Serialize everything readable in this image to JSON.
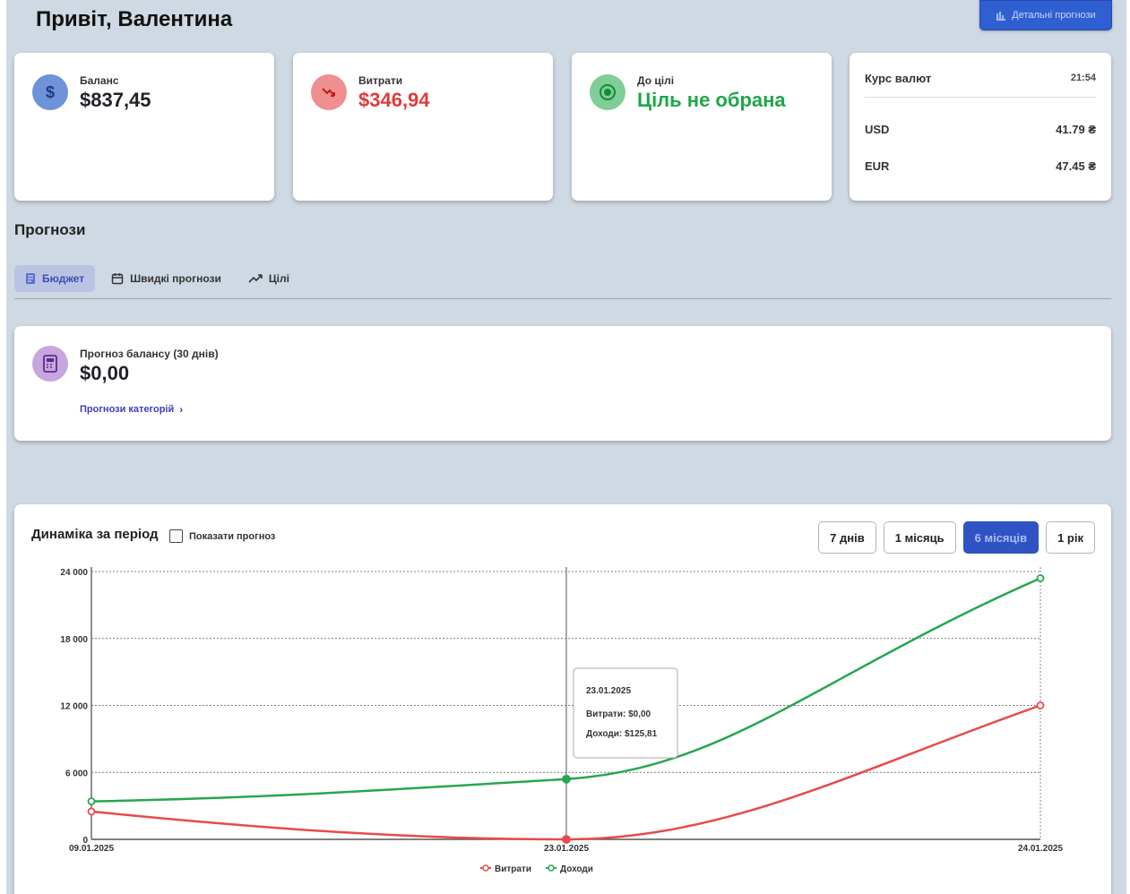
{
  "header": {
    "greeting": "Привіт, Валентина",
    "detail_button": "Детальні прогнози"
  },
  "stats": {
    "balance": {
      "label": "Баланс",
      "value": "$837,45",
      "icon": "dollar-icon",
      "icon_color": "#6f93d8",
      "value_color": "#1f2328"
    },
    "expenses": {
      "label": "Витрати",
      "value": "$346,94",
      "icon": "trend-down-icon",
      "icon_color": "#ef8f8f",
      "value_color": "#e03b3b"
    },
    "goal": {
      "label": "До цілі",
      "value": "Ціль не обрана",
      "icon": "target-icon",
      "icon_color": "#7fce97",
      "value_color": "#1fa64a"
    }
  },
  "rates": {
    "title": "Курс валют",
    "time": "21:54",
    "rows": [
      {
        "currency": "USD",
        "value": "41.79 ₴"
      },
      {
        "currency": "EUR",
        "value": "47.45 ₴"
      }
    ]
  },
  "forecasts": {
    "title": "Прогнози",
    "tabs": [
      {
        "label": "Бюджет",
        "icon": "budget-icon"
      },
      {
        "label": "Швидкі прогнози",
        "icon": "calendar-icon"
      },
      {
        "label": "Цілі",
        "icon": "trend-up-icon"
      }
    ],
    "balance_forecast_label": "Прогноз балансу (30 днів)",
    "balance_forecast_value": "$0,00",
    "categories_link": "Прогнози категорій"
  },
  "chart": {
    "title": "Динаміка за період",
    "show_forecast_label": "Показати прогноз",
    "ranges": [
      "7 днів",
      "1 місяць",
      "6 місяців",
      "1 рік"
    ],
    "active_range": "6 місяців",
    "tooltip": {
      "date": "23.01.2025",
      "expense_line": "Витрати: $0,00",
      "income_line": "Доходи: $125,81"
    }
  },
  "chart_data": {
    "type": "line",
    "x": [
      "09.01.2025",
      "23.01.2025",
      "24.01.2025"
    ],
    "series": [
      {
        "name": "Витрати",
        "color": "#e84a4a",
        "values": [
          2500,
          0,
          12000
        ]
      },
      {
        "name": "Доходи",
        "color": "#27a651",
        "values": [
          3400,
          5400,
          23400
        ]
      }
    ],
    "ylim": [
      0,
      24000
    ],
    "yticks": [
      0,
      6000,
      12000,
      18000,
      24000
    ],
    "ytick_labels": [
      "0",
      "6 000",
      "12 000",
      "18 000",
      "24 000"
    ],
    "grid": true,
    "legend": "bottom-center"
  }
}
